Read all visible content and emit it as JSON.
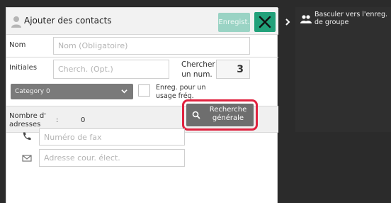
{
  "header": {
    "title": "Ajouter des contacts",
    "save_label": "Enregist.",
    "icons": {
      "person": "person-icon",
      "close": "close-icon"
    }
  },
  "form": {
    "name_label": "Nom",
    "name_placeholder": "Nom (Obligatoire)",
    "initials_label": "Initiales",
    "initials_placeholder": "Cherch. (Opt.)",
    "search_num_label": "Chercher un num.",
    "search_num_value": "3",
    "category_value": "Category 0",
    "frequent_label": "Enreg. pour un usage fréq.",
    "frequent_checked": false,
    "address_count_label": "Nombre d' adresses",
    "address_count_colon": ":",
    "address_count_value": "0",
    "global_search_label": "Recherche générale",
    "fax_placeholder": "Numéro de fax",
    "email_placeholder": "Adresse cour. élect."
  },
  "side": {
    "group_toggle_label": "Basculer vers l'enreg. de groupe",
    "icons": {
      "expand": "chevron-right-icon",
      "group": "group-icon"
    }
  },
  "colors": {
    "accent": "#22a17a",
    "save_disabled": "#9ad3c4",
    "highlight_ring": "#e0223f",
    "background": "#2b2b2b"
  }
}
